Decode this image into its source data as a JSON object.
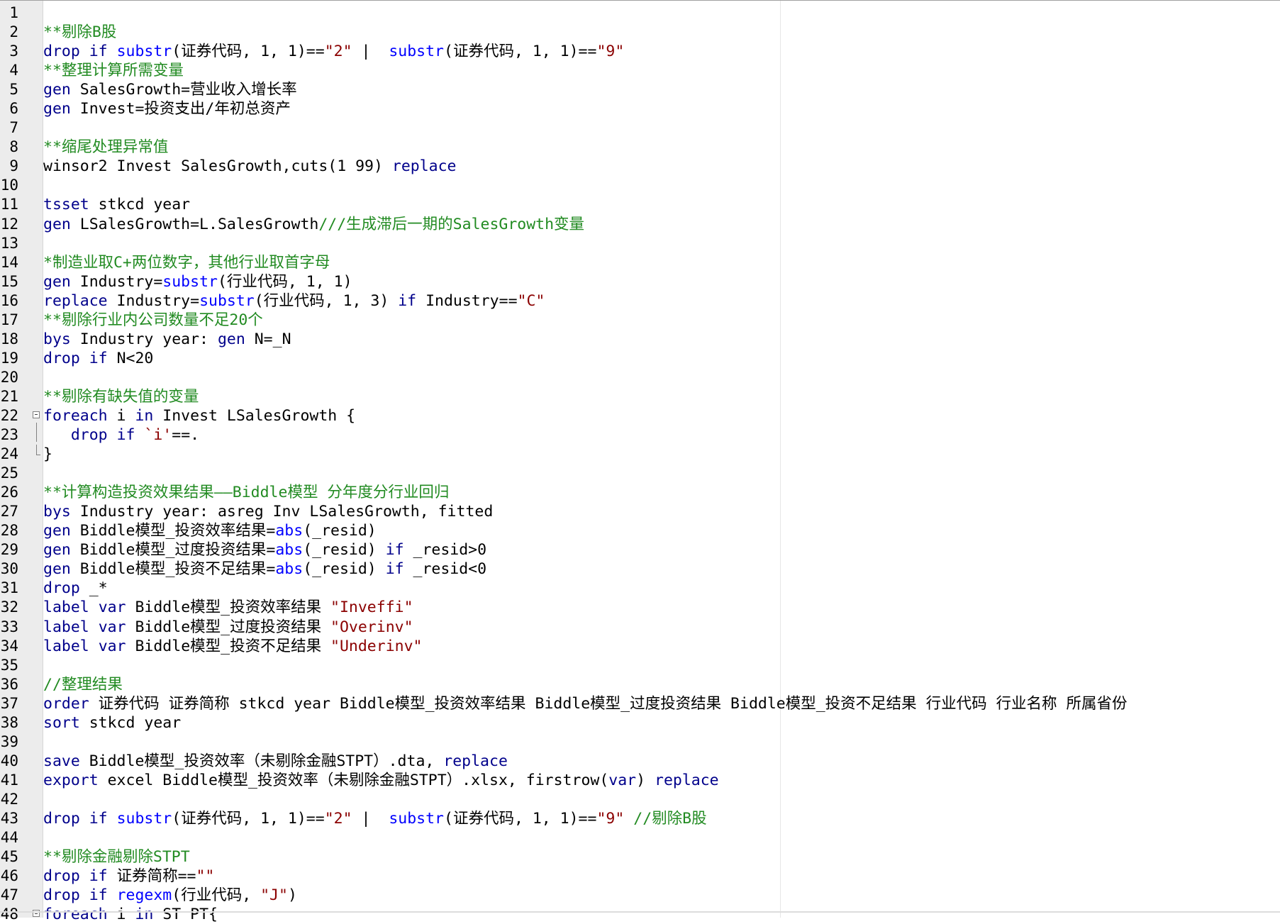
{
  "lines": [
    {
      "n": "1",
      "toks": []
    },
    {
      "n": "2",
      "toks": [
        [
          "cm",
          "**剔除B股"
        ]
      ]
    },
    {
      "n": "3",
      "toks": [
        [
          "kw",
          "drop"
        ],
        [
          "t",
          " "
        ],
        [
          "kw",
          "if"
        ],
        [
          "t",
          " "
        ],
        [
          "fn",
          "substr"
        ],
        [
          "t",
          "(证券代码, 1, 1)=="
        ],
        [
          "str",
          "\"2\""
        ],
        [
          "t",
          " |  "
        ],
        [
          "fn",
          "substr"
        ],
        [
          "t",
          "(证券代码, 1, 1)=="
        ],
        [
          "str",
          "\"9\""
        ]
      ]
    },
    {
      "n": "4",
      "toks": [
        [
          "cm",
          "**整理计算所需变量"
        ]
      ]
    },
    {
      "n": "5",
      "toks": [
        [
          "kw",
          "gen"
        ],
        [
          "t",
          " SalesGrowth=营业收入增长率"
        ]
      ]
    },
    {
      "n": "6",
      "toks": [
        [
          "kw",
          "gen"
        ],
        [
          "t",
          " Invest=投资支出/年初总资产"
        ]
      ]
    },
    {
      "n": "7",
      "toks": []
    },
    {
      "n": "8",
      "toks": [
        [
          "cm",
          "**缩尾处理异常值"
        ]
      ]
    },
    {
      "n": "9",
      "toks": [
        [
          "t",
          "winsor2 Invest SalesGrowth,cuts(1 99) "
        ],
        [
          "kw",
          "replace"
        ]
      ]
    },
    {
      "n": "10",
      "toks": []
    },
    {
      "n": "11",
      "toks": [
        [
          "kw",
          "tsset"
        ],
        [
          "t",
          " stkcd year"
        ]
      ]
    },
    {
      "n": "12",
      "toks": [
        [
          "kw",
          "gen"
        ],
        [
          "t",
          " LSalesGrowth=L.SalesGrowth"
        ],
        [
          "cm",
          "///生成滞后一期的SalesGrowth变量"
        ]
      ]
    },
    {
      "n": "13",
      "toks": []
    },
    {
      "n": "14",
      "toks": [
        [
          "cm",
          "*制造业取C+两位数字，其他行业取首字母"
        ]
      ]
    },
    {
      "n": "15",
      "toks": [
        [
          "kw",
          "gen"
        ],
        [
          "t",
          " Industry="
        ],
        [
          "fn",
          "substr"
        ],
        [
          "t",
          "(行业代码, 1, 1)"
        ]
      ]
    },
    {
      "n": "16",
      "toks": [
        [
          "kw",
          "replace"
        ],
        [
          "t",
          " Industry="
        ],
        [
          "fn",
          "substr"
        ],
        [
          "t",
          "(行业代码, 1, 3) "
        ],
        [
          "kw",
          "if"
        ],
        [
          "t",
          " Industry=="
        ],
        [
          "str",
          "\"C\""
        ]
      ]
    },
    {
      "n": "17",
      "toks": [
        [
          "cm",
          "**剔除行业内公司数量不足20个"
        ]
      ]
    },
    {
      "n": "18",
      "toks": [
        [
          "kw",
          "bys"
        ],
        [
          "t",
          " Industry year: "
        ],
        [
          "kw",
          "gen"
        ],
        [
          "t",
          " N=_N"
        ]
      ]
    },
    {
      "n": "19",
      "toks": [
        [
          "kw",
          "drop"
        ],
        [
          "t",
          " "
        ],
        [
          "kw",
          "if"
        ],
        [
          "t",
          " N<20"
        ]
      ]
    },
    {
      "n": "20",
      "toks": []
    },
    {
      "n": "21",
      "toks": [
        [
          "cm",
          "**剔除有缺失值的变量"
        ]
      ]
    },
    {
      "n": "22",
      "toks": [
        [
          "kw",
          "foreach"
        ],
        [
          "t",
          " i "
        ],
        [
          "kw",
          "in"
        ],
        [
          "t",
          " Invest LSalesGrowth {"
        ]
      ]
    },
    {
      "n": "23",
      "toks": [
        [
          "t",
          "   "
        ],
        [
          "kw",
          "drop"
        ],
        [
          "t",
          " "
        ],
        [
          "kw",
          "if"
        ],
        [
          "t",
          " "
        ],
        [
          "str",
          "`i'"
        ],
        [
          "t",
          "==."
        ]
      ]
    },
    {
      "n": "24",
      "toks": [
        [
          "t",
          "}"
        ]
      ]
    },
    {
      "n": "25",
      "toks": []
    },
    {
      "n": "26",
      "toks": [
        [
          "cm",
          "**计算构造投资效果结果——Biddle模型 分年度分行业回归"
        ]
      ]
    },
    {
      "n": "27",
      "toks": [
        [
          "kw",
          "bys"
        ],
        [
          "t",
          " Industry year: asreg Inv LSalesGrowth, fitted"
        ]
      ]
    },
    {
      "n": "28",
      "toks": [
        [
          "kw",
          "gen"
        ],
        [
          "t",
          " Biddle模型_投资效率结果="
        ],
        [
          "fn",
          "abs"
        ],
        [
          "t",
          "(_resid)"
        ]
      ]
    },
    {
      "n": "29",
      "toks": [
        [
          "kw",
          "gen"
        ],
        [
          "t",
          " Biddle模型_过度投资结果="
        ],
        [
          "fn",
          "abs"
        ],
        [
          "t",
          "(_resid) "
        ],
        [
          "kw",
          "if"
        ],
        [
          "t",
          " _resid>0"
        ]
      ]
    },
    {
      "n": "30",
      "toks": [
        [
          "kw",
          "gen"
        ],
        [
          "t",
          " Biddle模型_投资不足结果="
        ],
        [
          "fn",
          "abs"
        ],
        [
          "t",
          "(_resid) "
        ],
        [
          "kw",
          "if"
        ],
        [
          "t",
          " _resid<0"
        ]
      ]
    },
    {
      "n": "31",
      "toks": [
        [
          "kw",
          "drop"
        ],
        [
          "t",
          " _*"
        ]
      ]
    },
    {
      "n": "32",
      "toks": [
        [
          "kw",
          "label"
        ],
        [
          "t",
          " "
        ],
        [
          "kw",
          "var"
        ],
        [
          "t",
          " Biddle模型_投资效率结果 "
        ],
        [
          "str",
          "\"Inveffi\""
        ]
      ]
    },
    {
      "n": "33",
      "toks": [
        [
          "kw",
          "label"
        ],
        [
          "t",
          " "
        ],
        [
          "kw",
          "var"
        ],
        [
          "t",
          " Biddle模型_过度投资结果 "
        ],
        [
          "str",
          "\"Overinv\""
        ]
      ]
    },
    {
      "n": "34",
      "toks": [
        [
          "kw",
          "label"
        ],
        [
          "t",
          " "
        ],
        [
          "kw",
          "var"
        ],
        [
          "t",
          " Biddle模型_投资不足结果 "
        ],
        [
          "str",
          "\"Underinv\""
        ]
      ]
    },
    {
      "n": "35",
      "toks": []
    },
    {
      "n": "36",
      "toks": [
        [
          "cm",
          "//整理结果"
        ]
      ]
    },
    {
      "n": "37",
      "toks": [
        [
          "kw",
          "order"
        ],
        [
          "t",
          " 证券代码 证券简称 stkcd year Biddle模型_投资效率结果 Biddle模型_过度投资结果 Biddle模型_投资不足结果 行业代码 行业名称 所属省份"
        ]
      ]
    },
    {
      "n": "38",
      "toks": [
        [
          "kw",
          "sort"
        ],
        [
          "t",
          " stkcd year"
        ]
      ]
    },
    {
      "n": "39",
      "toks": []
    },
    {
      "n": "40",
      "toks": [
        [
          "kw",
          "save"
        ],
        [
          "t",
          " Biddle模型_投资效率（未剔除金融STPT）.dta, "
        ],
        [
          "kw",
          "replace"
        ]
      ]
    },
    {
      "n": "41",
      "toks": [
        [
          "kw",
          "export"
        ],
        [
          "t",
          " excel Biddle模型_投资效率（未剔除金融STPT）.xlsx, firstrow("
        ],
        [
          "kw",
          "var"
        ],
        [
          "t",
          ") "
        ],
        [
          "kw",
          "replace"
        ]
      ]
    },
    {
      "n": "42",
      "toks": []
    },
    {
      "n": "43",
      "toks": [
        [
          "kw",
          "drop"
        ],
        [
          "t",
          " "
        ],
        [
          "kw",
          "if"
        ],
        [
          "t",
          " "
        ],
        [
          "fn",
          "substr"
        ],
        [
          "t",
          "(证券代码, 1, 1)=="
        ],
        [
          "str",
          "\"2\""
        ],
        [
          "t",
          " |  "
        ],
        [
          "fn",
          "substr"
        ],
        [
          "t",
          "(证券代码, 1, 1)=="
        ],
        [
          "str",
          "\"9\""
        ],
        [
          "t",
          " "
        ],
        [
          "cm",
          "//剔除B股"
        ]
      ]
    },
    {
      "n": "44",
      "toks": []
    },
    {
      "n": "45",
      "toks": [
        [
          "cm",
          "**剔除金融剔除STPT"
        ]
      ]
    },
    {
      "n": "46",
      "toks": [
        [
          "kw",
          "drop"
        ],
        [
          "t",
          " "
        ],
        [
          "kw",
          "if"
        ],
        [
          "t",
          " 证券简称=="
        ],
        [
          "str",
          "\"\""
        ]
      ]
    },
    {
      "n": "47",
      "toks": [
        [
          "kw",
          "drop"
        ],
        [
          "t",
          " "
        ],
        [
          "kw",
          "if"
        ],
        [
          "t",
          " "
        ],
        [
          "fn",
          "regexm"
        ],
        [
          "t",
          "(行业代码, "
        ],
        [
          "str",
          "\"J\""
        ],
        [
          "t",
          ")"
        ]
      ]
    },
    {
      "n": "48",
      "toks": [
        [
          "kw",
          "foreach"
        ],
        [
          "t",
          " i "
        ],
        [
          "kw",
          "in"
        ],
        [
          "t",
          " ST PT{"
        ]
      ]
    }
  ]
}
